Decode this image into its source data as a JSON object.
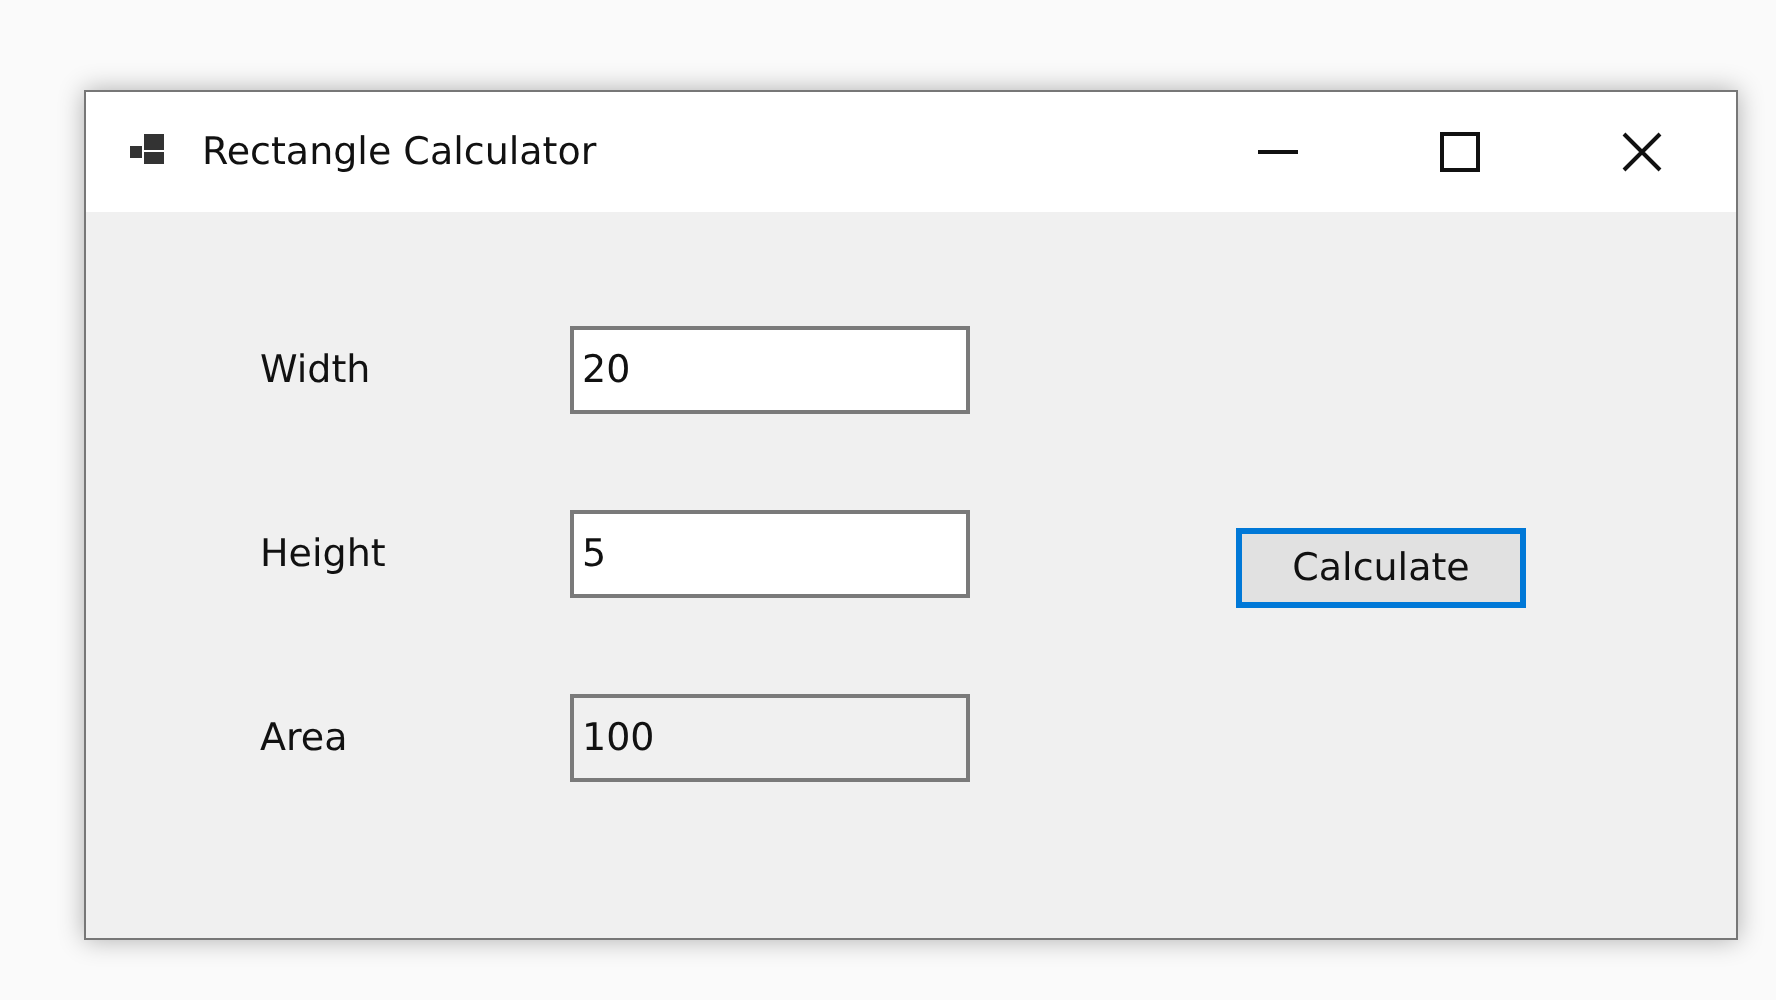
{
  "window": {
    "title": "Rectangle Calculator"
  },
  "fields": [
    {
      "label": "Width",
      "value": "20",
      "readonly": false
    },
    {
      "label": "Height",
      "value": "5",
      "readonly": false
    },
    {
      "label": "Area",
      "value": "100",
      "readonly": true
    }
  ],
  "button": {
    "label": "Calculate",
    "focused": true
  }
}
